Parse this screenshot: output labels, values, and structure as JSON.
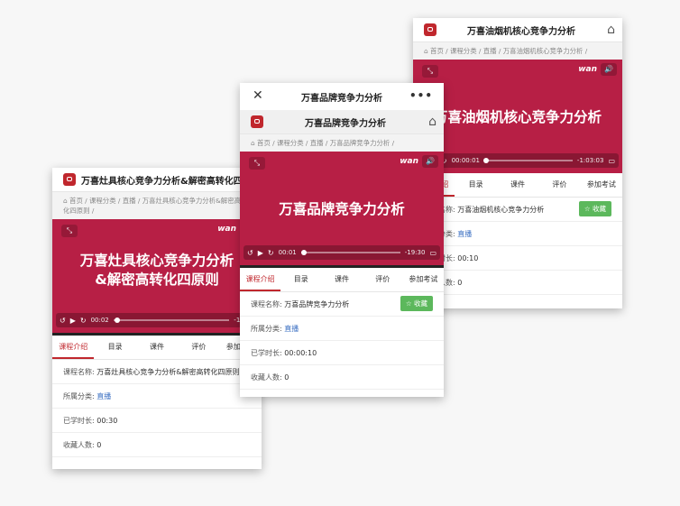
{
  "colors": {
    "brand": "#c0272d",
    "video_bg": "#b71f45",
    "favorite_button": "#5cb85c",
    "link": "#3a6fc2"
  },
  "tab_labels": [
    "课程介绍",
    "目录",
    "课件",
    "评价",
    "参加考试"
  ],
  "labels": {
    "course_name": "课程名称:",
    "category": "所属分类:",
    "study_time": "已学时长:",
    "favorites_count": "收藏人数:",
    "favorite_button": "☆ 收藏"
  },
  "cards": {
    "left": {
      "header_title": "万喜灶具核心竞争力分析&解密高转化四原则",
      "breadcrumb": "首页 / 课程分类 / 直播 / 万喜灶具核心竞争力分析&解密高转化四原则 /",
      "video_title": "万喜灶具核心竞争力分析\n&解密高转化四原则",
      "time_current": "00:02",
      "time_remaining": "-16:02",
      "progress": 0.02,
      "course_name": "万喜灶具核心竞争力分析&解密高转化四原则",
      "category": "直播",
      "study_time": "00:30",
      "favorites": "0"
    },
    "middle": {
      "window_title": "万喜品牌竞争力分析",
      "header_title": "万喜品牌竞争力分析",
      "breadcrumb": "首页 / 课程分类 / 直播 / 万喜品牌竞争力分析 /",
      "video_title": "万喜品牌竞争力分析",
      "time_current": "00:01",
      "time_remaining": "-19:30",
      "progress": 0.01,
      "course_name": "万喜品牌竞争力分析",
      "category": "直播",
      "study_time": "00:00:10",
      "favorites": "0"
    },
    "right": {
      "header_title": "万喜油烟机核心竞争力分析",
      "breadcrumb": "首页 / 课程分类 / 直播 / 万喜油烟机核心竞争力分析 /",
      "video_title": "万喜油烟机核心竞争力分析",
      "time_current": "00:00:01",
      "time_remaining": "-1:03:03",
      "progress": 0.0,
      "course_name": "万喜油烟机核心竞争力分析",
      "category": "直播",
      "study_time": "00:10",
      "favorites": "0"
    }
  },
  "icons": {
    "close": "close-icon",
    "more": "more-icon",
    "home": "home-icon",
    "expand": "expand-icon",
    "volume": "volume-icon",
    "rewind": "rewind-icon",
    "play": "play-icon",
    "forward": "forward-icon",
    "airplay": "airplay-icon",
    "logo": "logo-icon"
  },
  "brand_watermark": "wan"
}
